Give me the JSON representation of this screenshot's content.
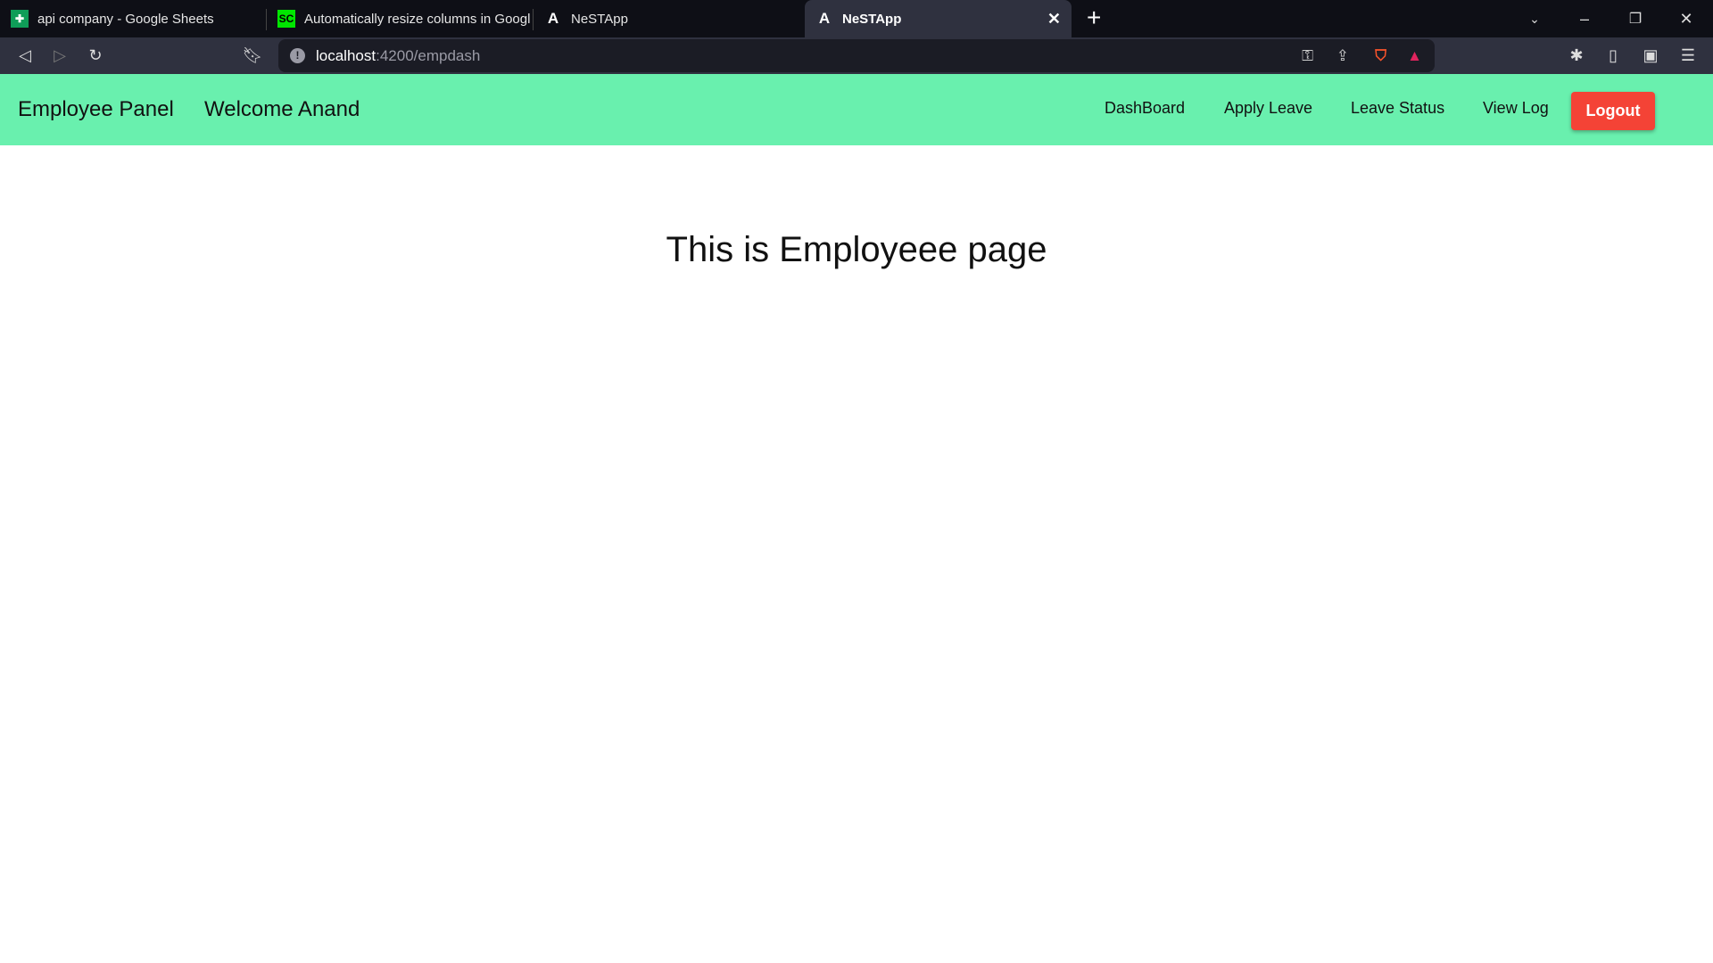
{
  "browser": {
    "tabs": [
      {
        "title": "api company - Google Sheets",
        "icon": "google-sheets-icon",
        "color": "#0f9d58"
      },
      {
        "title": "Automatically resize columns in Googl",
        "icon": "sc-site-icon",
        "color": "#00e600",
        "icon_text": "SC"
      },
      {
        "title": "NeSTApp",
        "icon": "angular-icon"
      },
      {
        "title": "NeSTApp",
        "icon": "angular-icon",
        "active": true
      }
    ],
    "url_host": "localhost",
    "url_path": ":4200/empdash"
  },
  "header": {
    "brand": "Employee Panel",
    "welcome": "Welcome Anand",
    "nav": [
      "DashBoard",
      "Apply Leave",
      "Leave Status",
      "View Log"
    ],
    "logout": "Logout",
    "color": "#69f0ae",
    "logout_color": "#f44336"
  },
  "main": {
    "title": "This is Employeee page"
  }
}
